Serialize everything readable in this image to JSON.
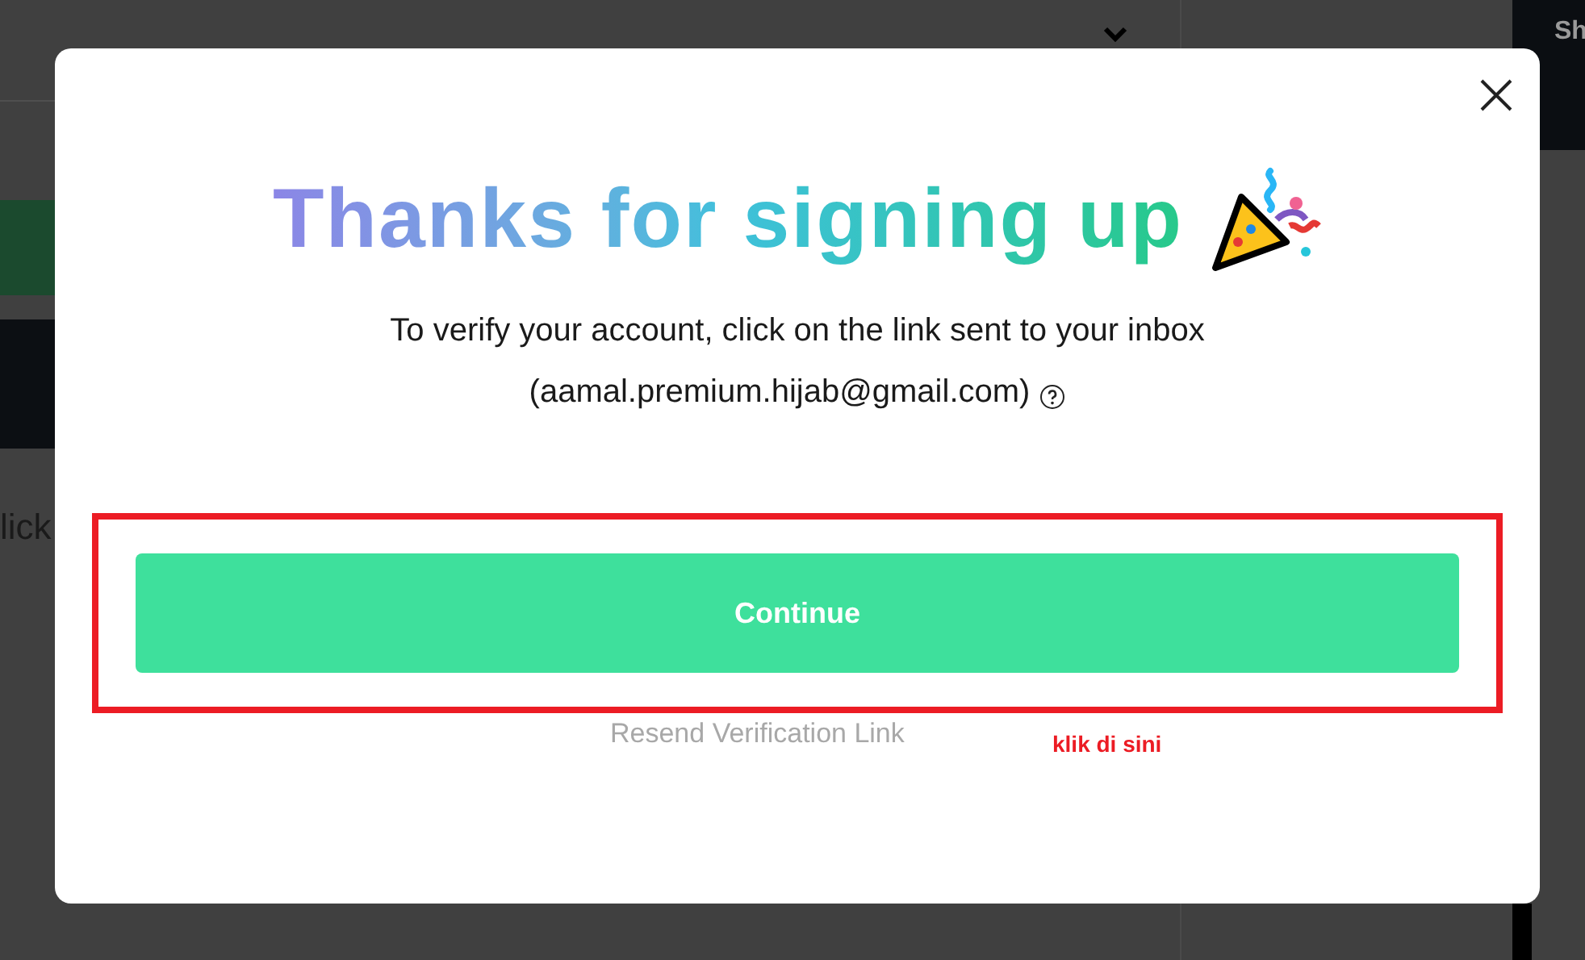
{
  "background_page": {
    "side_button": "Sh",
    "body_text": "lick"
  },
  "modal": {
    "title": "Thanks for signing up",
    "message": "To verify your account, click on the link sent to your inbox",
    "email": "(aamal.premium.hijab@gmail.com)",
    "continue_button": "Continue",
    "resend_link": "Resend Verification Link"
  },
  "annotation": {
    "text": "klik di sini"
  }
}
